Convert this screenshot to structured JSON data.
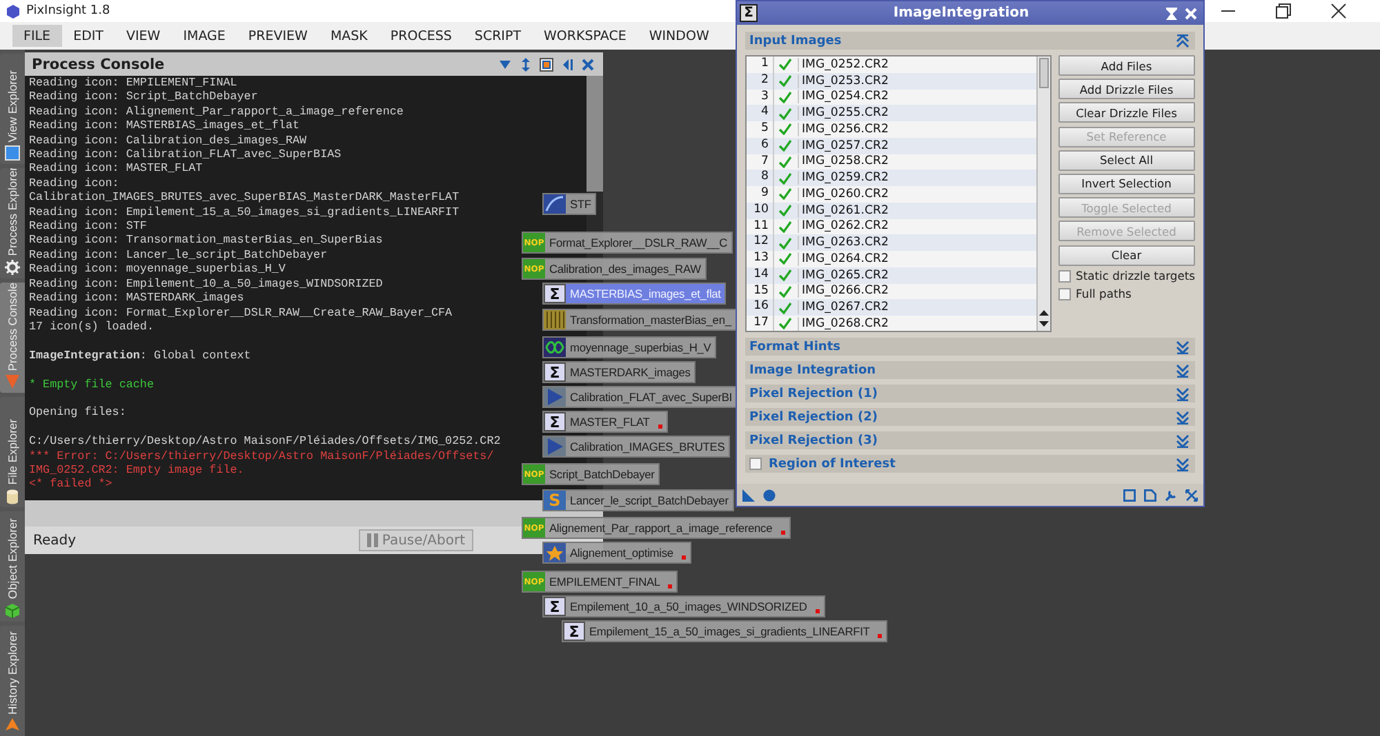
{
  "app": {
    "title": "PixInsight 1.8"
  },
  "menu": [
    {
      "label": "FILE",
      "selected": true
    },
    {
      "label": "EDIT",
      "selected": false
    },
    {
      "label": "VIEW",
      "selected": false
    },
    {
      "label": "IMAGE",
      "selected": false
    },
    {
      "label": "PREVIEW",
      "selected": false
    },
    {
      "label": "MASK",
      "selected": false
    },
    {
      "label": "PROCESS",
      "selected": false
    },
    {
      "label": "SCRIPT",
      "selected": false
    },
    {
      "label": "WORKSPACE",
      "selected": false
    },
    {
      "label": "WINDOW",
      "selected": false
    }
  ],
  "side_tabs": [
    {
      "label": "View Explorer",
      "kind": "view",
      "selected": false
    },
    {
      "label": "Process Explorer",
      "kind": "process",
      "selected": false
    },
    {
      "label": "Process Console",
      "kind": "console",
      "selected": true
    },
    {
      "label": "File Explorer",
      "kind": "file",
      "selected": false
    },
    {
      "label": "Object Explorer",
      "kind": "object",
      "selected": false
    },
    {
      "label": "History Explorer",
      "kind": "history",
      "selected": false
    }
  ],
  "console": {
    "title": "Process Console",
    "blocks": [
      {
        "lines": [
          {
            "text": "Reading icon: EMPILEMENT_FINAL",
            "kind": "info"
          },
          {
            "text": "Reading icon: Script_BatchDebayer",
            "kind": "info"
          },
          {
            "text": "Reading icon: Alignement_Par_rapport_a_image_reference",
            "kind": "info"
          },
          {
            "text": "Reading icon: MASTERBIAS_images_et_flat",
            "kind": "info"
          },
          {
            "text": "Reading icon: Calibration_des_images_RAW",
            "kind": "info"
          },
          {
            "text": "Reading icon: Calibration_FLAT_avec_SuperBIAS",
            "kind": "info"
          },
          {
            "text": "Reading icon: MASTER_FLAT",
            "kind": "info"
          },
          {
            "text": "Reading icon:",
            "kind": "info"
          },
          {
            "text": "Calibration_IMAGES_BRUTES_avec_SuperBIAS_MasterDARK_MasterFLAT",
            "kind": "info"
          },
          {
            "text": "Reading icon: Empilement_15_a_50_images_si_gradients_LINEARFIT",
            "kind": "info"
          },
          {
            "text": "Reading icon: STF",
            "kind": "info"
          },
          {
            "text": "Reading icon: Transormation_masterBias_en_SuperBias",
            "kind": "info"
          },
          {
            "text": "Reading icon: Lancer_le_script_BatchDebayer",
            "kind": "info"
          },
          {
            "text": "Reading icon: moyennage_superbias_H_V",
            "kind": "info"
          },
          {
            "text": "Reading icon: Empilement_10_a_50_images_WINDSORIZED",
            "kind": "info"
          },
          {
            "text": "Reading icon: MASTERDARK_images",
            "kind": "info"
          },
          {
            "text": "Reading icon: Format_Explorer__DSLR_RAW__Create_RAW_Bayer_CFA",
            "kind": "info"
          },
          {
            "text": "17 icon(s) loaded.",
            "kind": "info"
          }
        ]
      },
      {
        "lines": [
          {
            "text": "**ImageIntegration**: Global context",
            "kind": "info"
          }
        ]
      },
      {
        "lines": [
          {
            "text": "* Empty file cache",
            "kind": "success"
          }
        ]
      },
      {
        "lines": [
          {
            "text": "Opening files:",
            "kind": "info"
          }
        ]
      },
      {
        "lines": [
          {
            "text": "C:/Users/thierry/Desktop/Astro MaisonF/Pléiades/Offsets/IMG_0252.CR2",
            "kind": "info"
          },
          {
            "text": "*** Error: C:/Users/thierry/Desktop/Astro MaisonF/Pléiades/Offsets/",
            "kind": "error"
          },
          {
            "text": "IMG_0252.CR2: Empty image file.",
            "kind": "error"
          },
          {
            "text": "<* failed *>",
            "kind": "error"
          }
        ]
      }
    ],
    "status": "Ready",
    "pause_button": "Pause/Abort"
  },
  "process_icons": [
    {
      "label": "STF",
      "kind": "stf",
      "selected": false,
      "flagged": false
    },
    {
      "label": "Format_Explorer__DSLR_RAW__C",
      "kind": "nop",
      "badge": "NOP",
      "selected": false,
      "flagged": false
    },
    {
      "label": "Calibration_des_images_RAW",
      "kind": "nop",
      "badge": "NOP",
      "selected": false,
      "flagged": false
    },
    {
      "label": "MASTERBIAS_images_et_flat",
      "kind": "sigma",
      "badge": "Σ",
      "selected": true,
      "flagged": false
    },
    {
      "label": "Transformation_masterBias_en_",
      "kind": "transform",
      "selected": false,
      "flagged": false
    },
    {
      "label": "moyennage_superbias_H_V",
      "kind": "average",
      "selected": false,
      "flagged": false
    },
    {
      "label": "MASTERDARK_images",
      "kind": "sigma",
      "badge": "Σ",
      "selected": false,
      "flagged": false
    },
    {
      "label": "Calibration_FLAT_avec_SuperBI",
      "kind": "calibration",
      "selected": false,
      "flagged": false
    },
    {
      "label": "MASTER_FLAT",
      "kind": "sigma",
      "badge": "Σ",
      "selected": false,
      "flagged": true
    },
    {
      "label": "Calibration_IMAGES_BRUTES",
      "kind": "calibration",
      "selected": false,
      "flagged": false
    },
    {
      "label": "Script_BatchDebayer",
      "kind": "nop",
      "badge": "NOP",
      "selected": false,
      "flagged": false
    },
    {
      "label": "Lancer_le_script_BatchDebayer",
      "kind": "script",
      "badge": "S",
      "selected": false,
      "flagged": false
    },
    {
      "label": "Alignement_Par_rapport_a_image_reference",
      "kind": "nop",
      "badge": "NOP",
      "selected": false,
      "flagged": true
    },
    {
      "label": "Alignement_optimise",
      "kind": "align",
      "selected": false,
      "flagged": true
    },
    {
      "label": "EMPILEMENT_FINAL",
      "kind": "nop",
      "badge": "NOP",
      "selected": false,
      "flagged": true
    },
    {
      "label": "Empilement_10_a_50_images_WINDSORIZED",
      "kind": "sigma",
      "badge": "Σ",
      "selected": false,
      "flagged": true
    },
    {
      "label": "Empilement_15_a_50_images_si_gradients_LINEARFIT",
      "kind": "sigma",
      "badge": "Σ",
      "selected": false,
      "flagged": true
    }
  ],
  "image_integration": {
    "title": "ImageIntegration",
    "badge": "Σ",
    "input_section": {
      "label": "Input Images",
      "expanded": true
    },
    "images": [
      {
        "index": "1",
        "name": "IMG_0252.CR2",
        "enabled": true
      },
      {
        "index": "2",
        "name": "IMG_0253.CR2",
        "enabled": true
      },
      {
        "index": "3",
        "name": "IMG_0254.CR2",
        "enabled": true
      },
      {
        "index": "4",
        "name": "IMG_0255.CR2",
        "enabled": true
      },
      {
        "index": "5",
        "name": "IMG_0256.CR2",
        "enabled": true
      },
      {
        "index": "6",
        "name": "IMG_0257.CR2",
        "enabled": true
      },
      {
        "index": "7",
        "name": "IMG_0258.CR2",
        "enabled": true
      },
      {
        "index": "8",
        "name": "IMG_0259.CR2",
        "enabled": true
      },
      {
        "index": "9",
        "name": "IMG_0260.CR2",
        "enabled": true
      },
      {
        "index": "10",
        "name": "IMG_0261.CR2",
        "enabled": true
      },
      {
        "index": "11",
        "name": "IMG_0262.CR2",
        "enabled": true
      },
      {
        "index": "12",
        "name": "IMG_0263.CR2",
        "enabled": true
      },
      {
        "index": "13",
        "name": "IMG_0264.CR2",
        "enabled": true
      },
      {
        "index": "14",
        "name": "IMG_0265.CR2",
        "enabled": true
      },
      {
        "index": "15",
        "name": "IMG_0266.CR2",
        "enabled": true
      },
      {
        "index": "16",
        "name": "IMG_0267.CR2",
        "enabled": true
      },
      {
        "index": "17",
        "name": "IMG_0268.CR2",
        "enabled": true
      }
    ],
    "buttons": [
      {
        "label": "Add Files",
        "disabled": false
      },
      {
        "label": "Add Drizzle Files",
        "disabled": false
      },
      {
        "label": "Clear Drizzle Files",
        "disabled": false
      },
      {
        "label": "Set Reference",
        "disabled": true
      },
      {
        "label": "Select All",
        "disabled": false
      },
      {
        "label": "Invert Selection",
        "disabled": false
      },
      {
        "label": "Toggle Selected",
        "disabled": true
      },
      {
        "label": "Remove Selected",
        "disabled": true
      },
      {
        "label": "Clear",
        "disabled": false
      }
    ],
    "options": [
      {
        "label": "Static drizzle targets",
        "checked": false
      },
      {
        "label": "Full paths",
        "checked": false
      }
    ],
    "sections": [
      {
        "label": "Format Hints",
        "kind": "plain",
        "expanded": false
      },
      {
        "label": "Image Integration",
        "kind": "plain",
        "expanded": false
      },
      {
        "label": "Pixel Rejection (1)",
        "kind": "plain",
        "expanded": false
      },
      {
        "label": "Pixel Rejection (2)",
        "kind": "plain",
        "expanded": false
      },
      {
        "label": "Pixel Rejection (3)",
        "kind": "plain",
        "expanded": false
      },
      {
        "label": "Region of Interest",
        "kind": "toggle",
        "checked": false,
        "expanded": false
      }
    ]
  }
}
